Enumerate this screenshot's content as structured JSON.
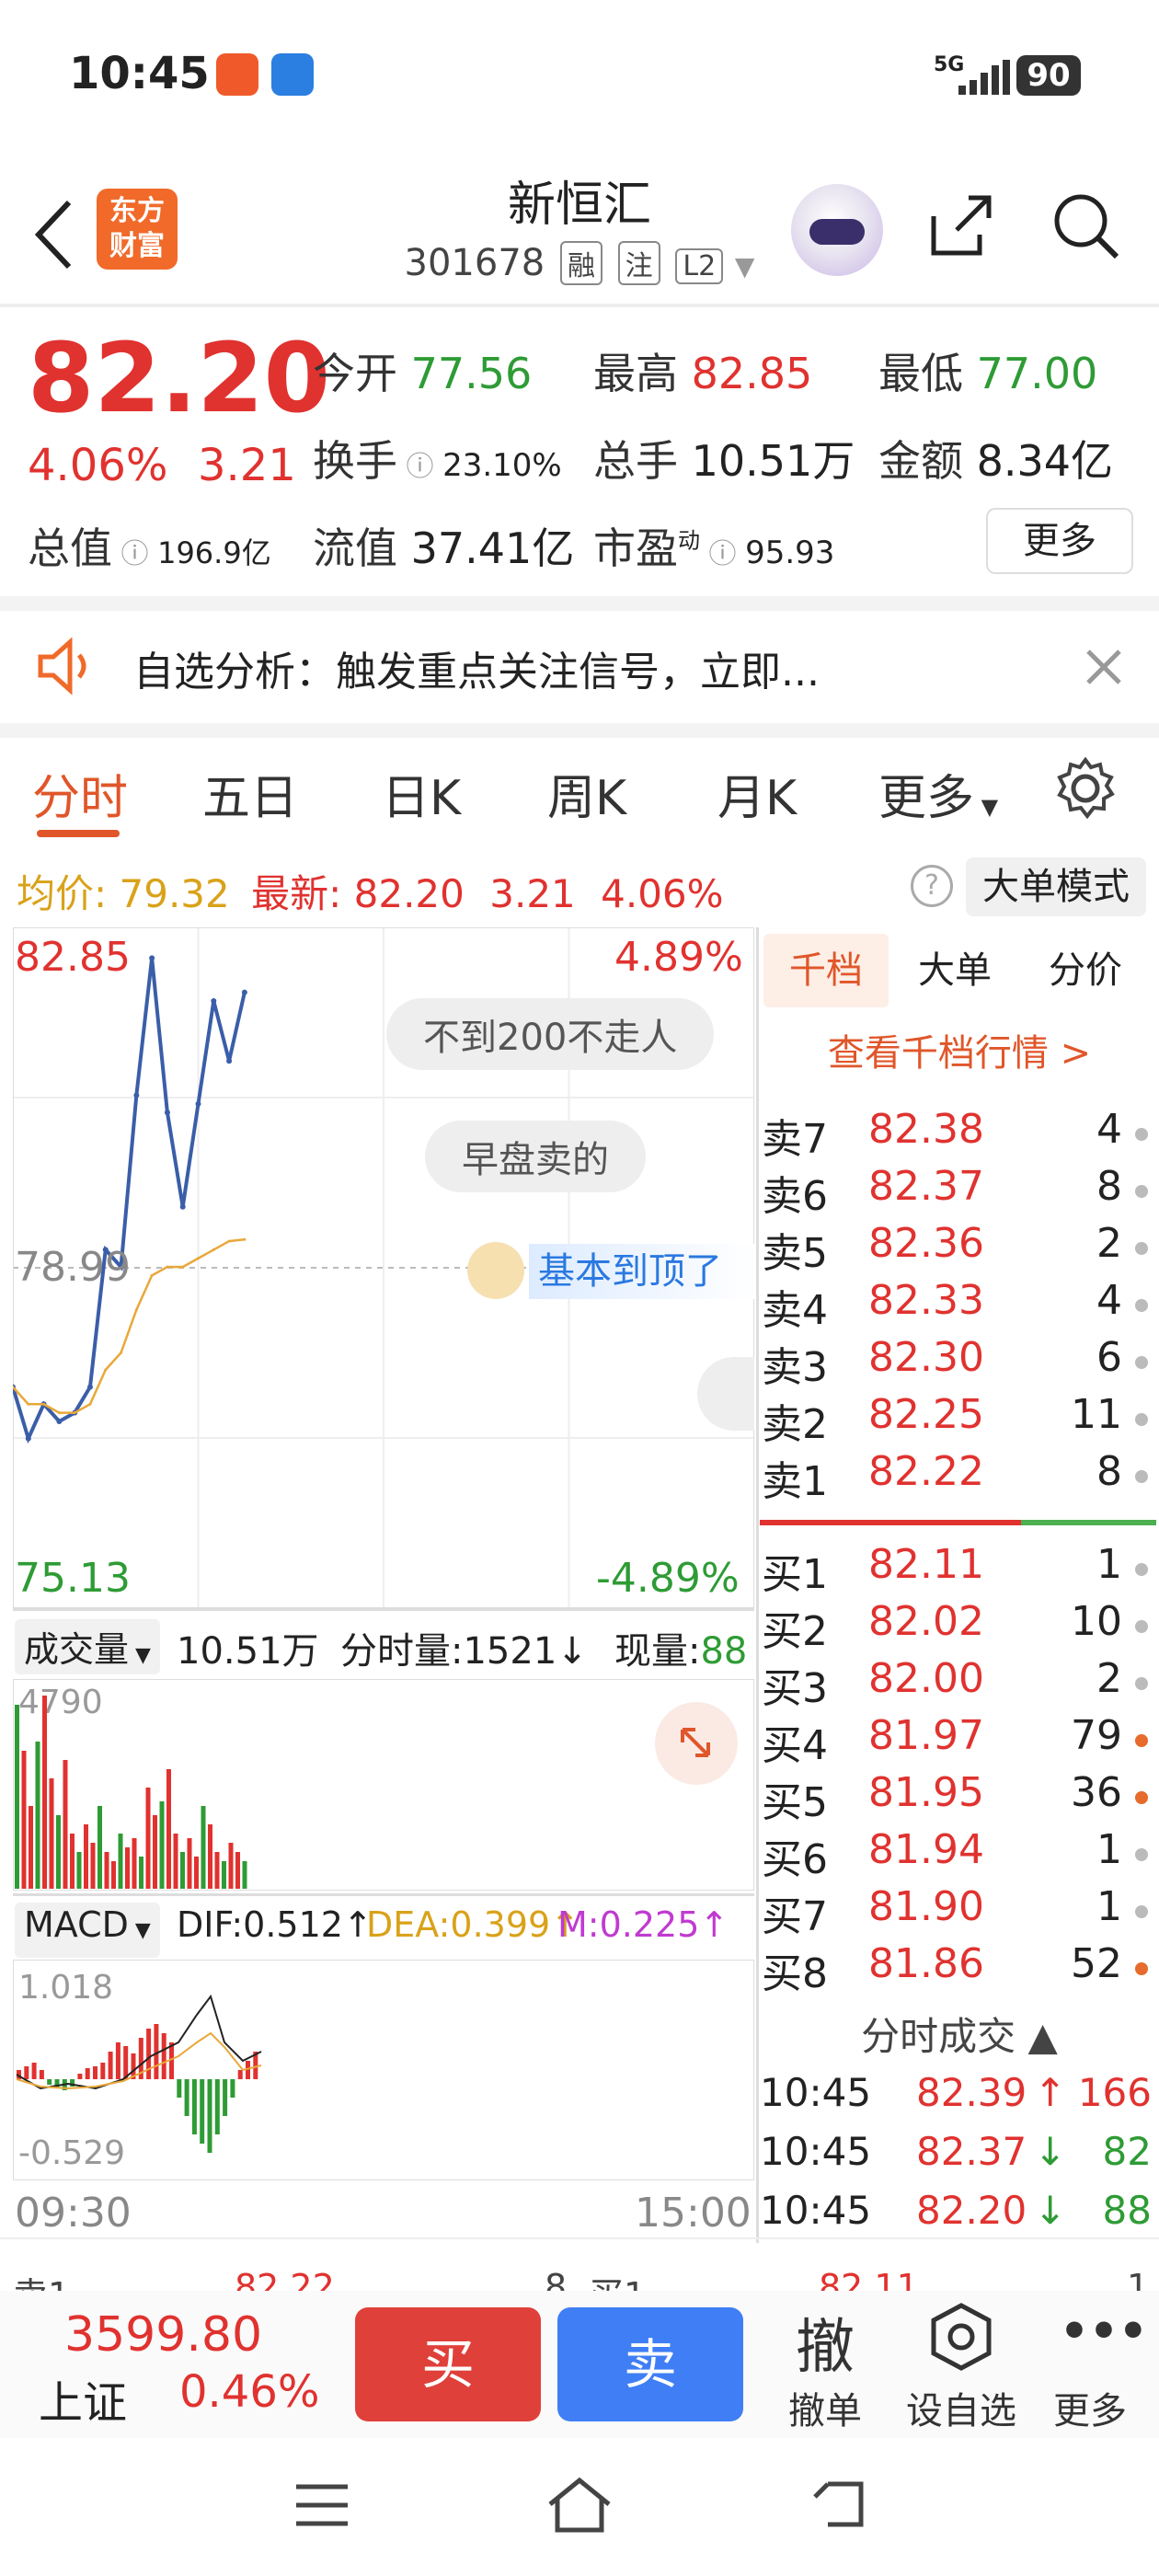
{
  "status_bar": {
    "time": "10:45",
    "network": "5G",
    "battery": "90"
  },
  "header": {
    "logo_line1": "东方",
    "logo_line2": "财富",
    "title": "新恒汇",
    "code": "301678",
    "tags": [
      "融",
      "注",
      "L2"
    ]
  },
  "quote": {
    "price": "82.20",
    "change_pct": "4.06%",
    "change": "3.21",
    "open_label": "今开",
    "open": "77.56",
    "high_label": "最高",
    "high": "82.85",
    "low_label": "最低",
    "low": "77.00",
    "turnover_label": "换手",
    "turnover": "23.10%",
    "volume_label": "总手",
    "volume": "10.51万",
    "amount_label": "金额",
    "amount": "8.34亿",
    "mktcap_label": "总值",
    "mktcap": "196.9亿",
    "float_label": "流值",
    "float": "37.41亿",
    "pe_label": "市盈",
    "pe_sup": "动",
    "pe": "95.93",
    "more": "更多"
  },
  "notice": {
    "text": "自选分析：触发重点关注信号，立即..."
  },
  "tabs": [
    "分时",
    "五日",
    "日K",
    "周K",
    "月K",
    "更多"
  ],
  "infoline": {
    "avg_label": "均价:",
    "avg": "79.32",
    "latest_label": "最新:",
    "latest": "82.20",
    "chg": "3.21",
    "pct": "4.06%",
    "big_mode": "大单模式"
  },
  "chart": {
    "top_price": "82.85",
    "top_pct": "4.89%",
    "mid_price": "78.99",
    "bottom_price": "75.13",
    "bottom_pct": "-4.89%",
    "bubbles": [
      "不到200不走人",
      "早盘卖的",
      "基本到顶了"
    ],
    "vol_label": "成交量",
    "vol_total": "10.51万",
    "vol_tick": "分时量:1521",
    "vol_now_label": "现量:",
    "vol_now": "88",
    "vol_max": "4790",
    "macd_label": "MACD",
    "dif": "DIF:0.512",
    "dea": "DEA:0.399",
    "m": "M:0.225",
    "macd_max": "1.018",
    "macd_min": "-0.529",
    "time_start": "09:30",
    "time_end": "15:00"
  },
  "chart_data": {
    "type": "line",
    "x": [
      "09:30",
      "09:35",
      "09:40",
      "09:45",
      "09:50",
      "09:55",
      "10:00",
      "10:05",
      "10:10",
      "10:15",
      "10:20",
      "10:25",
      "10:30",
      "10:35",
      "10:40",
      "10:45"
    ],
    "series": [
      {
        "values": [
          77.6,
          77.0,
          77.4,
          77.2,
          77.3,
          77.6,
          79.2,
          79.0,
          81.0,
          82.6,
          80.8,
          79.7,
          80.9,
          82.1,
          81.4,
          82.2
        ]
      },
      {
        "values": [
          77.6,
          77.4,
          77.4,
          77.3,
          77.3,
          77.4,
          77.8,
          78.0,
          78.5,
          78.9,
          79.0,
          79.0,
          79.1,
          79.2,
          79.3,
          79.32
        ]
      }
    ],
    "ylim": [
      75.13,
      82.85
    ],
    "xlim": [
      "09:30",
      "15:00"
    ]
  },
  "book": {
    "tabs": [
      "千档",
      "大单",
      "分价"
    ],
    "link": "查看千档行情 >",
    "asks": [
      {
        "label": "卖7",
        "price": "82.38",
        "vol": "4"
      },
      {
        "label": "卖6",
        "price": "82.37",
        "vol": "8"
      },
      {
        "label": "卖5",
        "price": "82.36",
        "vol": "2"
      },
      {
        "label": "卖4",
        "price": "82.33",
        "vol": "4"
      },
      {
        "label": "卖3",
        "price": "82.30",
        "vol": "6"
      },
      {
        "label": "卖2",
        "price": "82.25",
        "vol": "11"
      },
      {
        "label": "卖1",
        "price": "82.22",
        "vol": "8"
      }
    ],
    "bids": [
      {
        "label": "买1",
        "price": "82.11",
        "vol": "1"
      },
      {
        "label": "买2",
        "price": "82.02",
        "vol": "10"
      },
      {
        "label": "买3",
        "price": "82.00",
        "vol": "2"
      },
      {
        "label": "买4",
        "price": "81.97",
        "vol": "79"
      },
      {
        "label": "买5",
        "price": "81.95",
        "vol": "36"
      },
      {
        "label": "买6",
        "price": "81.94",
        "vol": "1"
      },
      {
        "label": "买7",
        "price": "81.90",
        "vol": "1"
      },
      {
        "label": "买8",
        "price": "81.86",
        "vol": "52"
      }
    ],
    "trades_label": "分时成交",
    "trades": [
      {
        "time": "10:45",
        "price": "82.39",
        "arrow": "↑",
        "vol": "166"
      },
      {
        "time": "10:45",
        "price": "82.37",
        "arrow": "↓",
        "vol": "82"
      },
      {
        "time": "10:45",
        "price": "82.20",
        "arrow": "↓",
        "vol": "88"
      }
    ]
  },
  "bottom": {
    "index_value": "3599.80",
    "index_name": "上证",
    "index_pct": "0.46%",
    "buy": "买",
    "sell": "卖",
    "cancel": "撤单",
    "cancel_glyph": "撤",
    "watch": "设自选",
    "more": "更多"
  }
}
